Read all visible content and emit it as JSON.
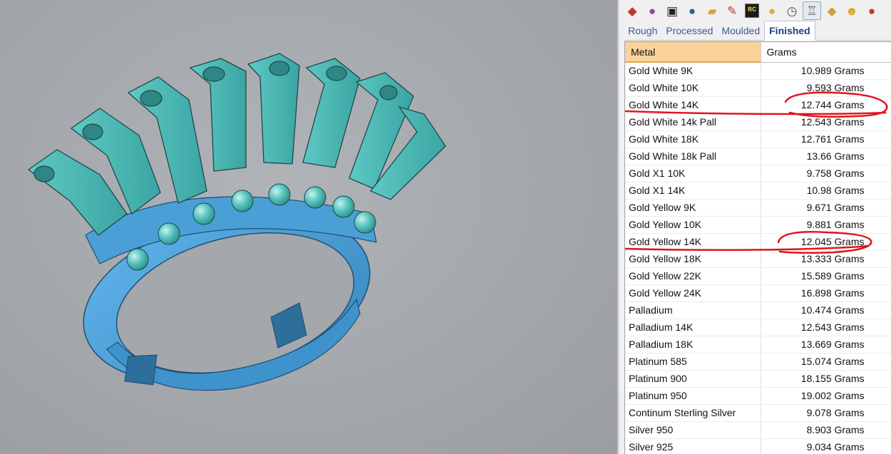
{
  "toolbar": {
    "icons": [
      {
        "name": "layers-icon",
        "glyph": "◆",
        "color": "#c0392b"
      },
      {
        "name": "color-wheel-icon",
        "glyph": "●",
        "color": "#8e44ad"
      },
      {
        "name": "monitor-icon",
        "glyph": "▣",
        "color": "#222222"
      },
      {
        "name": "material-sphere-icon",
        "glyph": "●",
        "color": "#2b5ea8"
      },
      {
        "name": "folder-open-icon",
        "glyph": "▰",
        "color": "#d4a437"
      },
      {
        "name": "brush-icon",
        "glyph": "✎",
        "color": "#b03a2e"
      },
      {
        "name": "rc-badge-icon",
        "glyph": "RC",
        "color": "#e8c64a"
      },
      {
        "name": "gold-ball-icon",
        "glyph": "●",
        "color": "#d9b03c"
      },
      {
        "name": "gauge-icon",
        "glyph": "◷",
        "color": "#555555"
      },
      {
        "name": "ring-weight-icon",
        "glyph": "♖",
        "color": "#555555"
      },
      {
        "name": "gold-nugget-icon",
        "glyph": "◆",
        "color": "#c9a23a"
      },
      {
        "name": "emoji-face-icon",
        "glyph": "☻",
        "color": "#d9a51f"
      },
      {
        "name": "bomb-icon",
        "glyph": "●",
        "color": "#c0392b"
      }
    ]
  },
  "tabs": [
    {
      "label": "Rough",
      "selected": false
    },
    {
      "label": "Processed",
      "selected": false
    },
    {
      "label": "Moulded",
      "selected": false
    },
    {
      "label": "Finished",
      "selected": true
    }
  ],
  "table": {
    "headers": {
      "metal": "Metal",
      "grams": "Grams"
    },
    "rows": [
      {
        "metal": "Gold White 9K",
        "grams": "10.989 Grams"
      },
      {
        "metal": "Gold White 10K",
        "grams": "9.593 Grams"
      },
      {
        "metal": "Gold White 14K",
        "grams": "12.744 Grams"
      },
      {
        "metal": "Gold White 14k Pall",
        "grams": "12.543 Grams"
      },
      {
        "metal": "Gold White 18K",
        "grams": "12.761 Grams"
      },
      {
        "metal": "Gold White 18k Pall",
        "grams": "13.66 Grams"
      },
      {
        "metal": "Gold X1 10K",
        "grams": "9.758 Grams"
      },
      {
        "metal": "Gold X1 14K",
        "grams": "10.98 Grams"
      },
      {
        "metal": "Gold Yellow 9K",
        "grams": "9.671 Grams"
      },
      {
        "metal": "Gold Yellow 10K",
        "grams": "9.881 Grams"
      },
      {
        "metal": "Gold Yellow 14K",
        "grams": "12.045 Grams"
      },
      {
        "metal": "Gold Yellow 18K",
        "grams": "13.333 Grams"
      },
      {
        "metal": "Gold Yellow 22K",
        "grams": "15.589 Grams"
      },
      {
        "metal": "Gold Yellow 24K",
        "grams": "16.898 Grams"
      },
      {
        "metal": "Palladium",
        "grams": "10.474 Grams"
      },
      {
        "metal": "Palladium 14K",
        "grams": "12.543 Grams"
      },
      {
        "metal": "Palladium 18K",
        "grams": "13.669 Grams"
      },
      {
        "metal": "Platinum 585",
        "grams": "15.074 Grams"
      },
      {
        "metal": "Platinum 900",
        "grams": "18.155 Grams"
      },
      {
        "metal": "Platinum 950",
        "grams": "19.002 Grams"
      },
      {
        "metal": "Continum Sterling Silver",
        "grams": "9.078 Grams"
      },
      {
        "metal": "Silver 950",
        "grams": "8.903 Grams"
      },
      {
        "metal": "Silver 925",
        "grams": "9.034 Grams"
      }
    ]
  },
  "colors": {
    "ring_band": "#4a9fd6",
    "ring_settings": "#44b3b0",
    "annotation": "#e0141e",
    "header_sorted": "#f9d39a"
  }
}
